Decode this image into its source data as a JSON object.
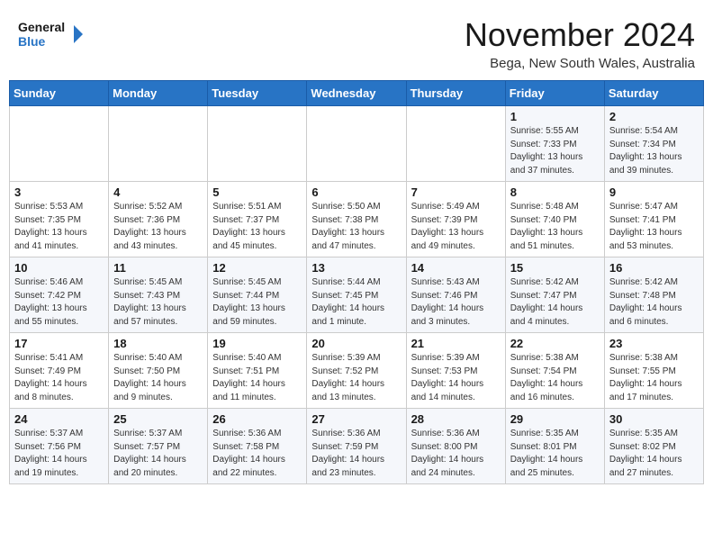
{
  "header": {
    "logo_line1": "General",
    "logo_line2": "Blue",
    "month": "November 2024",
    "location": "Bega, New South Wales, Australia"
  },
  "weekdays": [
    "Sunday",
    "Monday",
    "Tuesday",
    "Wednesday",
    "Thursday",
    "Friday",
    "Saturday"
  ],
  "weeks": [
    [
      {
        "day": "",
        "info": ""
      },
      {
        "day": "",
        "info": ""
      },
      {
        "day": "",
        "info": ""
      },
      {
        "day": "",
        "info": ""
      },
      {
        "day": "",
        "info": ""
      },
      {
        "day": "1",
        "info": "Sunrise: 5:55 AM\nSunset: 7:33 PM\nDaylight: 13 hours\nand 37 minutes."
      },
      {
        "day": "2",
        "info": "Sunrise: 5:54 AM\nSunset: 7:34 PM\nDaylight: 13 hours\nand 39 minutes."
      }
    ],
    [
      {
        "day": "3",
        "info": "Sunrise: 5:53 AM\nSunset: 7:35 PM\nDaylight: 13 hours\nand 41 minutes."
      },
      {
        "day": "4",
        "info": "Sunrise: 5:52 AM\nSunset: 7:36 PM\nDaylight: 13 hours\nand 43 minutes."
      },
      {
        "day": "5",
        "info": "Sunrise: 5:51 AM\nSunset: 7:37 PM\nDaylight: 13 hours\nand 45 minutes."
      },
      {
        "day": "6",
        "info": "Sunrise: 5:50 AM\nSunset: 7:38 PM\nDaylight: 13 hours\nand 47 minutes."
      },
      {
        "day": "7",
        "info": "Sunrise: 5:49 AM\nSunset: 7:39 PM\nDaylight: 13 hours\nand 49 minutes."
      },
      {
        "day": "8",
        "info": "Sunrise: 5:48 AM\nSunset: 7:40 PM\nDaylight: 13 hours\nand 51 minutes."
      },
      {
        "day": "9",
        "info": "Sunrise: 5:47 AM\nSunset: 7:41 PM\nDaylight: 13 hours\nand 53 minutes."
      }
    ],
    [
      {
        "day": "10",
        "info": "Sunrise: 5:46 AM\nSunset: 7:42 PM\nDaylight: 13 hours\nand 55 minutes."
      },
      {
        "day": "11",
        "info": "Sunrise: 5:45 AM\nSunset: 7:43 PM\nDaylight: 13 hours\nand 57 minutes."
      },
      {
        "day": "12",
        "info": "Sunrise: 5:45 AM\nSunset: 7:44 PM\nDaylight: 13 hours\nand 59 minutes."
      },
      {
        "day": "13",
        "info": "Sunrise: 5:44 AM\nSunset: 7:45 PM\nDaylight: 14 hours\nand 1 minute."
      },
      {
        "day": "14",
        "info": "Sunrise: 5:43 AM\nSunset: 7:46 PM\nDaylight: 14 hours\nand 3 minutes."
      },
      {
        "day": "15",
        "info": "Sunrise: 5:42 AM\nSunset: 7:47 PM\nDaylight: 14 hours\nand 4 minutes."
      },
      {
        "day": "16",
        "info": "Sunrise: 5:42 AM\nSunset: 7:48 PM\nDaylight: 14 hours\nand 6 minutes."
      }
    ],
    [
      {
        "day": "17",
        "info": "Sunrise: 5:41 AM\nSunset: 7:49 PM\nDaylight: 14 hours\nand 8 minutes."
      },
      {
        "day": "18",
        "info": "Sunrise: 5:40 AM\nSunset: 7:50 PM\nDaylight: 14 hours\nand 9 minutes."
      },
      {
        "day": "19",
        "info": "Sunrise: 5:40 AM\nSunset: 7:51 PM\nDaylight: 14 hours\nand 11 minutes."
      },
      {
        "day": "20",
        "info": "Sunrise: 5:39 AM\nSunset: 7:52 PM\nDaylight: 14 hours\nand 13 minutes."
      },
      {
        "day": "21",
        "info": "Sunrise: 5:39 AM\nSunset: 7:53 PM\nDaylight: 14 hours\nand 14 minutes."
      },
      {
        "day": "22",
        "info": "Sunrise: 5:38 AM\nSunset: 7:54 PM\nDaylight: 14 hours\nand 16 minutes."
      },
      {
        "day": "23",
        "info": "Sunrise: 5:38 AM\nSunset: 7:55 PM\nDaylight: 14 hours\nand 17 minutes."
      }
    ],
    [
      {
        "day": "24",
        "info": "Sunrise: 5:37 AM\nSunset: 7:56 PM\nDaylight: 14 hours\nand 19 minutes."
      },
      {
        "day": "25",
        "info": "Sunrise: 5:37 AM\nSunset: 7:57 PM\nDaylight: 14 hours\nand 20 minutes."
      },
      {
        "day": "26",
        "info": "Sunrise: 5:36 AM\nSunset: 7:58 PM\nDaylight: 14 hours\nand 22 minutes."
      },
      {
        "day": "27",
        "info": "Sunrise: 5:36 AM\nSunset: 7:59 PM\nDaylight: 14 hours\nand 23 minutes."
      },
      {
        "day": "28",
        "info": "Sunrise: 5:36 AM\nSunset: 8:00 PM\nDaylight: 14 hours\nand 24 minutes."
      },
      {
        "day": "29",
        "info": "Sunrise: 5:35 AM\nSunset: 8:01 PM\nDaylight: 14 hours\nand 25 minutes."
      },
      {
        "day": "30",
        "info": "Sunrise: 5:35 AM\nSunset: 8:02 PM\nDaylight: 14 hours\nand 27 minutes."
      }
    ]
  ]
}
